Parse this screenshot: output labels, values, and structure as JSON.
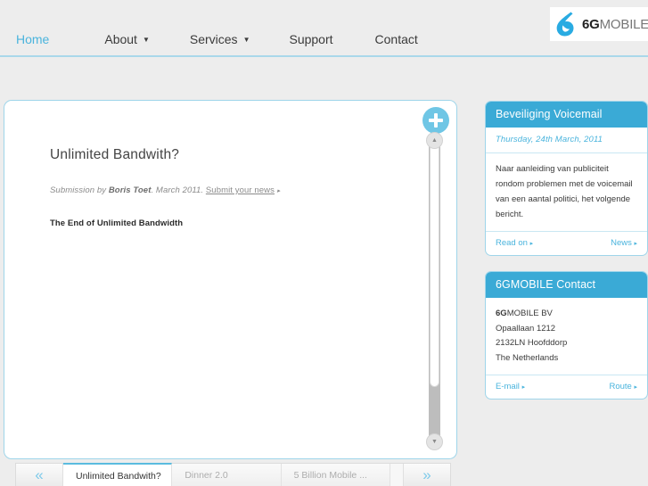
{
  "header": {
    "nav": [
      {
        "label": "Home",
        "active": true,
        "has_caret": false
      },
      {
        "label": "About",
        "active": false,
        "has_caret": true
      },
      {
        "label": "Services",
        "active": false,
        "has_caret": true
      },
      {
        "label": "Support",
        "active": false,
        "has_caret": false
      },
      {
        "label": "Contact",
        "active": false,
        "has_caret": false
      }
    ],
    "caret_glyph": "▼",
    "logo": {
      "bold": "6G",
      "light": "MOBILE"
    },
    "accent_color": "#4ab4dd",
    "border_color": "#a9d8ea"
  },
  "main": {
    "article": {
      "title": "Unlimited Bandwith?",
      "meta_prefix": "Submission by ",
      "meta_author": "Boris Toet",
      "meta_date": ". March 2011. ",
      "meta_submit": "Submit your news",
      "meta_arrow": "▸",
      "subhead": "The End of Unlimited Bandwidth"
    },
    "plus_button_label": "+",
    "scrollbar": {
      "up_glyph": "▲",
      "down_glyph": "▼"
    }
  },
  "tabbar": {
    "prev_glyph": "«",
    "next_glyph": "»",
    "tabs": [
      {
        "label": "Unlimited Bandwith?",
        "active": true
      },
      {
        "label": "Dinner 2.0",
        "active": false
      },
      {
        "label": "5 Billion Mobile ...",
        "active": false
      }
    ]
  },
  "sidebar": {
    "widgets": [
      {
        "title": "Beveiliging Voicemail",
        "date": "Thursday, 24th March, 2011",
        "body": "Naar aanleiding van publiciteit rondom problemen met de voicemail van een aantal politici, het volgende bericht.",
        "link_left": "Read on",
        "link_right": "News",
        "arrow": "▸"
      },
      {
        "title": "6GMOBILE Contact",
        "address_bold": "6G",
        "address_line1_rest": "MOBILE BV",
        "address_line2": "Opaallaan 1212",
        "address_line3": "2132LN Hoofddorp",
        "address_line4": "The Netherlands",
        "link_left": "E-mail",
        "link_right": "Route",
        "arrow": "▸"
      }
    ]
  },
  "colors": {
    "page_background": "#ededed",
    "panel_border": "#9fd5ea",
    "widget_header": "#3aaad6",
    "accent": "#4ab4dd",
    "plus_button": "#6fc6e5"
  }
}
